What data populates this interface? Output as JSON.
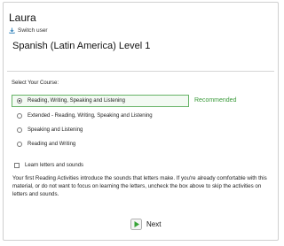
{
  "user": {
    "name": "Laura",
    "switch_label": "Switch user"
  },
  "course": {
    "title": "Spanish (Latin America) Level 1"
  },
  "selection": {
    "label": "Select Your Course:",
    "recommended_label": "Recommended",
    "options": [
      {
        "label": "Reading, Writing, Speaking and Listening",
        "selected": true
      },
      {
        "label": "Extended - Reading, Writing, Speaking and Listening",
        "selected": false
      },
      {
        "label": "Speaking and Listening",
        "selected": false
      },
      {
        "label": "Reading and Writing",
        "selected": false
      }
    ]
  },
  "letters": {
    "checkbox_label": "Learn letters and sounds",
    "checked": false,
    "description": "Your first Reading Activities introduce the sounds that letters make. If you're already comfortable with this material, or do not want to focus on learning the letters, uncheck the box above to skip the activities on letters and sounds."
  },
  "actions": {
    "next_label": "Next"
  },
  "colors": {
    "accent": "#3a9a3a",
    "selected_border": "#66b366",
    "selected_bg": "#f3faf3",
    "next_icon_green": "#36a336"
  },
  "icons": {
    "switch_user": "user-download-icon",
    "next": "play-next-icon"
  }
}
